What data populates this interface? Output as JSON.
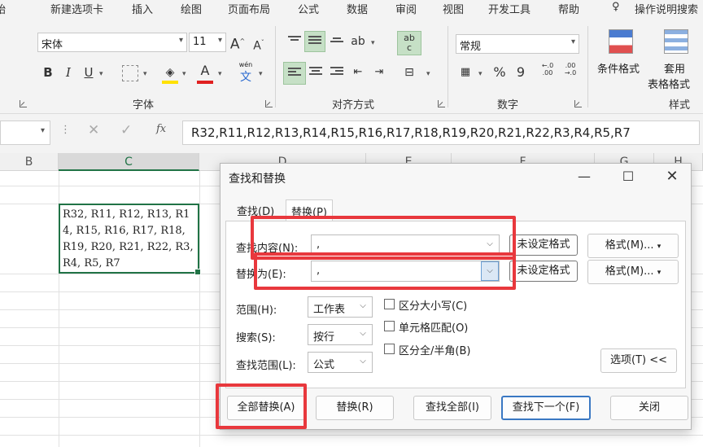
{
  "ribbon": {
    "tabs": [
      "新建选项卡",
      "插入",
      "绘图",
      "页面布局",
      "公式",
      "数据",
      "审阅",
      "视图",
      "开发工具",
      "帮助"
    ],
    "tell_me": "操作说明搜索",
    "font_name": "宋体",
    "font_size": "11",
    "grow_font": "A",
    "shrink_font": "A",
    "bold": "B",
    "italic": "I",
    "underline": "U",
    "font_color_glyph": "A",
    "phonetic_top": "wén",
    "phonetic_bottom": "文",
    "wrap_glyph": "ab",
    "wrap_glyph2": "c",
    "number_format": "常规",
    "percent": "%",
    "comma": "9",
    "group_font": "字体",
    "group_align": "对齐方式",
    "group_number": "数字",
    "group_styles": "样式",
    "cond_format": "条件格式",
    "table_format_1": "套用",
    "table_format_2": "表格格式"
  },
  "formula_bar": {
    "fx": "fx",
    "content": "R32,R11,R12,R13,R14,R15,R16,R17,R18,R19,R20,R21,R22,R3,R4,R5,R7"
  },
  "sheet": {
    "columns": [
      "B",
      "C",
      "D",
      "E",
      "F",
      "G",
      "H"
    ],
    "active_column": "C",
    "cell_c_text": "R32, R11, R12, R13, R14, R15, R16, R17, R18, R19, R20, R21, R22, R3, R4, R5, R7"
  },
  "dialog": {
    "title": "查找和替换",
    "tabs": [
      "查找(D)",
      "替换(P)"
    ],
    "active_tab": "替换(P)",
    "find_label": "查找内容(N):",
    "find_value": ",",
    "replace_label": "替换为(E):",
    "replace_value": ",",
    "no_format": "未设定格式",
    "format_button": "格式(M)...",
    "scope_label": "范围(H):",
    "scope_value": "工作表",
    "search_label": "搜索(S):",
    "search_value": "按行",
    "lookin_label": "查找范围(L):",
    "lookin_value": "公式",
    "match_case": "区分大小写(C)",
    "match_cell": "单元格匹配(O)",
    "match_width": "区分全/半角(B)",
    "options_button": "选项(T) <<",
    "replace_all": "全部替换(A)",
    "replace": "替换(R)",
    "find_all": "查找全部(I)",
    "find_next": "查找下一个(F)",
    "close": "关闭"
  },
  "colors": {
    "excel_green": "#217346",
    "highlight_red": "#e8383d",
    "primary_blue": "#3a78c3"
  }
}
